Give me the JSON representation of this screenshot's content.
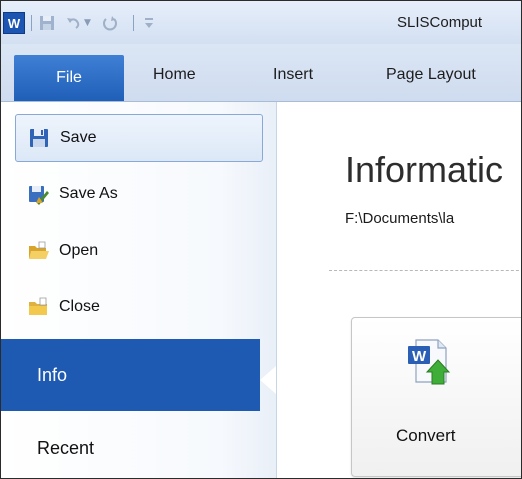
{
  "window": {
    "title": "SLISComput",
    "app_logo_letter": "W"
  },
  "ribbon": {
    "tabs": [
      {
        "label": "File",
        "active": true
      },
      {
        "label": "Home"
      },
      {
        "label": "Insert"
      },
      {
        "label": "Page Layout"
      }
    ]
  },
  "backstage": {
    "commands": [
      {
        "label": "Save",
        "icon": "floppy-disk-icon",
        "selected": true
      },
      {
        "label": "Save As",
        "icon": "save-as-icon"
      },
      {
        "label": "Open",
        "icon": "open-folder-icon"
      },
      {
        "label": "Close",
        "icon": "close-folder-icon"
      }
    ],
    "tabs": [
      {
        "label": "Info",
        "active": true
      },
      {
        "label": "Recent"
      }
    ]
  },
  "info": {
    "title": "Informatic",
    "path": "F:\\Documents\\la",
    "convert_label": "Convert"
  },
  "colors": {
    "accent": "#1f5ab2",
    "file_tab": "#2a68c2",
    "titlebar": "#dbe6f5"
  }
}
